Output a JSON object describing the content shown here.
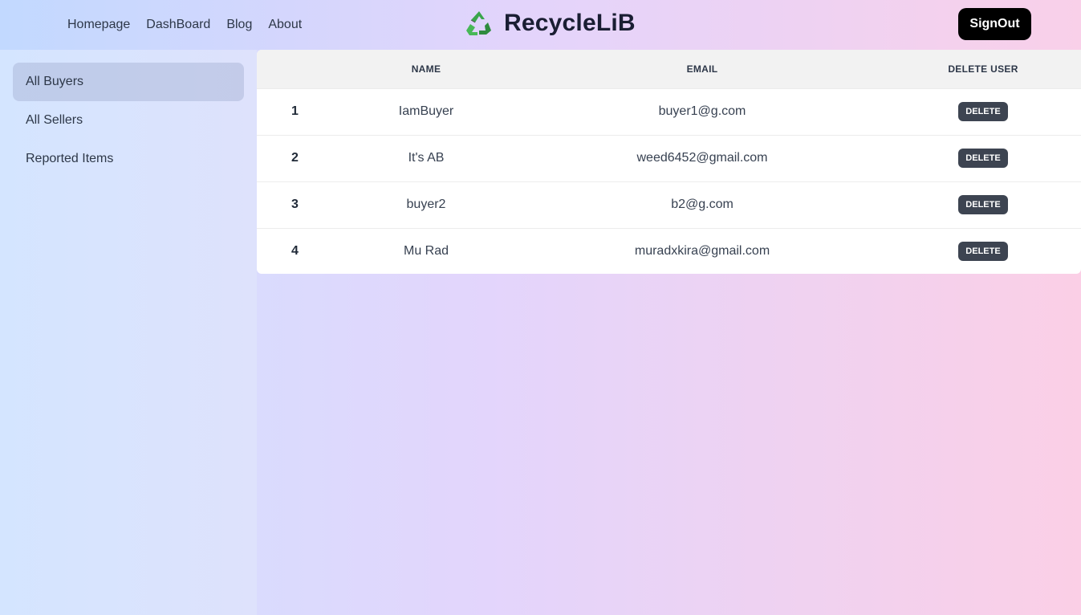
{
  "nav": {
    "items": [
      "Homepage",
      "DashBoard",
      "Blog",
      "About"
    ]
  },
  "brand": {
    "title": "RecycleLiB",
    "icon": "recycle-icon"
  },
  "header": {
    "signout_label": "SignOut"
  },
  "sidebar": {
    "items": [
      {
        "label": "All Buyers",
        "active": true
      },
      {
        "label": "All Sellers",
        "active": false
      },
      {
        "label": "Reported Items",
        "active": false
      }
    ]
  },
  "table": {
    "columns": [
      "",
      "Name",
      "Email",
      "Delete User"
    ],
    "rows": [
      {
        "index": "1",
        "name": "IamBuyer",
        "email": "buyer1@g.com",
        "action": "DELETE"
      },
      {
        "index": "2",
        "name": "It's AB",
        "email": "weed6452@gmail.com",
        "action": "DELETE"
      },
      {
        "index": "3",
        "name": "buyer2",
        "email": "b2@g.com",
        "action": "DELETE"
      },
      {
        "index": "4",
        "name": "Mu Rad",
        "email": "muradxkira@gmail.com",
        "action": "DELETE"
      }
    ]
  },
  "colors": {
    "signout_bg": "#000000",
    "delete_btn_bg": "#3d4451",
    "recycle_green": "#3aa54b"
  }
}
